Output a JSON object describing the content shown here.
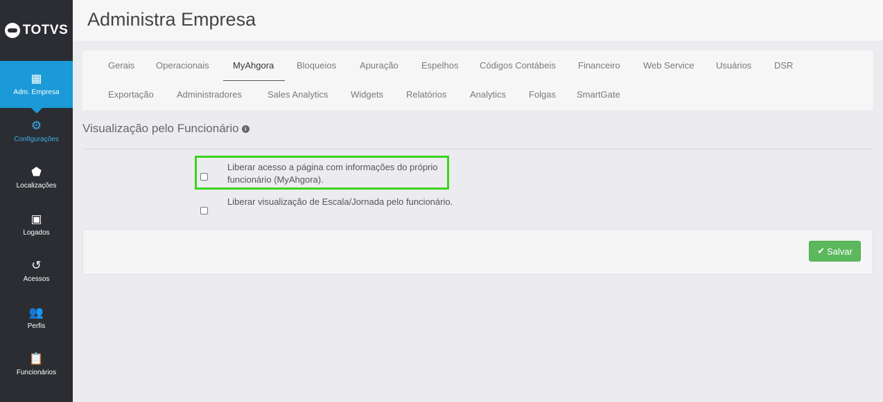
{
  "brand": {
    "name": "TOTVS"
  },
  "sidebar": {
    "items": [
      {
        "label": "Adm. Empresa",
        "icon": "building-gear-icon",
        "glyph": "▦"
      },
      {
        "label": "Configurações",
        "icon": "gear-icon",
        "glyph": "⚙"
      },
      {
        "label": "Localizações",
        "icon": "tag-icon",
        "glyph": "⬟"
      },
      {
        "label": "Logados",
        "icon": "id-card-icon",
        "glyph": "▣"
      },
      {
        "label": "Acessos",
        "icon": "history-icon",
        "glyph": "↺"
      },
      {
        "label": "Perfis",
        "icon": "users-icon",
        "glyph": "👥"
      },
      {
        "label": "Funcionários",
        "icon": "clipboard-user-icon",
        "glyph": "📋"
      }
    ]
  },
  "header": {
    "title": "Administra Empresa"
  },
  "tabs": {
    "row1": [
      "Gerais",
      "Operacionais",
      "MyAhgora",
      "Bloqueios",
      "Apuração",
      "Espelhos",
      "Códigos Contábeis",
      "Financeiro",
      "Web Service",
      "Usuários",
      "DSR"
    ],
    "row2": [
      "Exportação",
      "Administradores",
      "Sales Analytics",
      "Widgets",
      "Relatórios",
      "Analytics",
      "Folgas",
      "SmartGate"
    ],
    "active": "MyAhgora"
  },
  "section": {
    "title": "Visualização pelo Funcionário",
    "info_icon": "i"
  },
  "options": [
    {
      "line1": "Liberar acesso a página com informações do próprio",
      "line2": "funcionário (MyAhgora).",
      "checked": false
    },
    {
      "line1": "Liberar visualização de Escala/Jornada pelo funcionário.",
      "checked": false
    }
  ],
  "actions": {
    "save_label": "Salvar",
    "save_icon": "✔"
  },
  "colors": {
    "sidebar": "#2b2d32",
    "accent": "#1a9ad6",
    "save": "#5cb85c",
    "highlight": "#3bd31c"
  }
}
